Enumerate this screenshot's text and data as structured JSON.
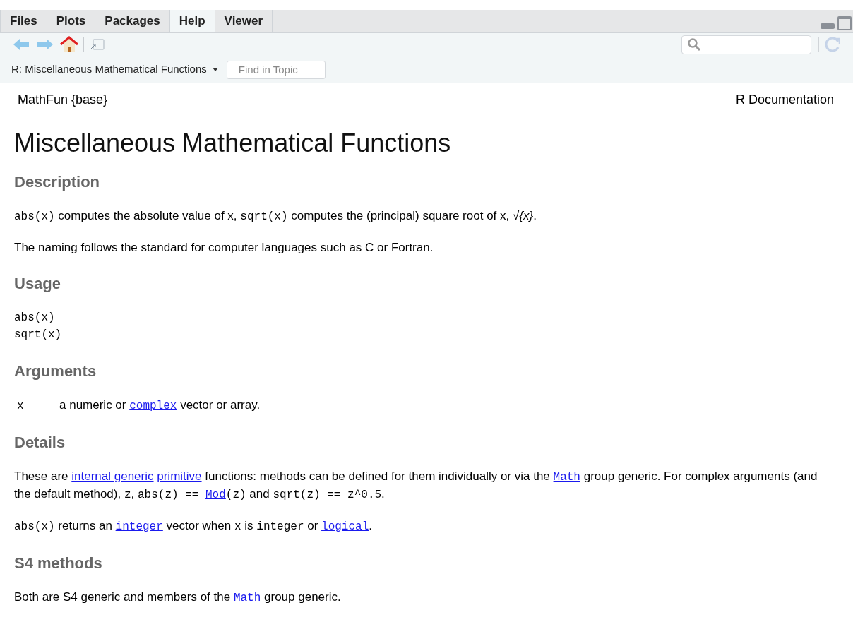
{
  "tabs": [
    {
      "label": "Files",
      "selected": false
    },
    {
      "label": "Plots",
      "selected": false
    },
    {
      "label": "Packages",
      "selected": false
    },
    {
      "label": "Help",
      "selected": true
    },
    {
      "label": "Viewer",
      "selected": false
    }
  ],
  "topic_bar": {
    "topic": "R: Miscellaneous Mathematical Functions",
    "find_placeholder": "Find in Topic"
  },
  "header": {
    "left": "MathFun {base}",
    "right": "R Documentation"
  },
  "title": "Miscellaneous Mathematical Functions",
  "sections": [
    {
      "heading": "Description",
      "blocks": [
        {
          "kind": "paragraph",
          "segments": [
            {
              "kind": "code",
              "text": "abs(x)"
            },
            {
              "kind": "text",
              "text": " computes the absolute value of x, "
            },
            {
              "kind": "code",
              "text": "sqrt(x)"
            },
            {
              "kind": "text",
              "text": " computes the (principal) square root of x, "
            },
            {
              "kind": "math",
              "text": "√{x}"
            },
            {
              "kind": "text",
              "text": "."
            }
          ]
        },
        {
          "kind": "paragraph",
          "segments": [
            {
              "kind": "text",
              "text": "The naming follows the standard for computer languages such as C or Fortran."
            }
          ]
        }
      ]
    },
    {
      "heading": "Usage",
      "blocks": [
        {
          "kind": "code",
          "lines": [
            "abs(x)",
            "sqrt(x)"
          ]
        }
      ]
    },
    {
      "heading": "Arguments",
      "blocks": [
        {
          "kind": "argument",
          "name": "x",
          "segments": [
            {
              "kind": "text",
              "text": "a numeric or "
            },
            {
              "kind": "codelink",
              "text": "complex"
            },
            {
              "kind": "text",
              "text": " vector or array."
            }
          ]
        }
      ]
    },
    {
      "heading": "Details",
      "blocks": [
        {
          "kind": "paragraph",
          "segments": [
            {
              "kind": "text",
              "text": "These are "
            },
            {
              "kind": "link",
              "text": "internal generic"
            },
            {
              "kind": "space"
            },
            {
              "kind": "link",
              "text": "primitive"
            },
            {
              "kind": "text",
              "text": " functions: methods can be defined for them individually or via the "
            },
            {
              "kind": "codelink",
              "text": "Math"
            },
            {
              "kind": "text",
              "text": " group generic. For complex arguments (and the default method), "
            },
            {
              "kind": "code",
              "text": "z"
            },
            {
              "kind": "text",
              "text": ", "
            },
            {
              "kind": "code",
              "text": "abs(z) == "
            },
            {
              "kind": "codelink",
              "text": "Mod"
            },
            {
              "kind": "code",
              "text": "(z)"
            },
            {
              "kind": "text",
              "text": " and "
            },
            {
              "kind": "code",
              "text": "sqrt(z) == z^0.5"
            },
            {
              "kind": "text",
              "text": "."
            }
          ]
        },
        {
          "kind": "paragraph",
          "segments": [
            {
              "kind": "code",
              "text": "abs(x)"
            },
            {
              "kind": "text",
              "text": " returns an "
            },
            {
              "kind": "codelink",
              "text": "integer"
            },
            {
              "kind": "text",
              "text": " vector when "
            },
            {
              "kind": "code",
              "text": "x"
            },
            {
              "kind": "text",
              "text": " is "
            },
            {
              "kind": "code",
              "text": "integer"
            },
            {
              "kind": "text",
              "text": " or "
            },
            {
              "kind": "codelink",
              "text": "logical"
            },
            {
              "kind": "text",
              "text": "."
            }
          ]
        }
      ]
    },
    {
      "heading": "S4 methods",
      "blocks": [
        {
          "kind": "paragraph",
          "segments": [
            {
              "kind": "text",
              "text": "Both are S4 generic and members of the "
            },
            {
              "kind": "codelink",
              "text": "Math"
            },
            {
              "kind": "text",
              "text": " group generic."
            }
          ]
        }
      ]
    }
  ]
}
